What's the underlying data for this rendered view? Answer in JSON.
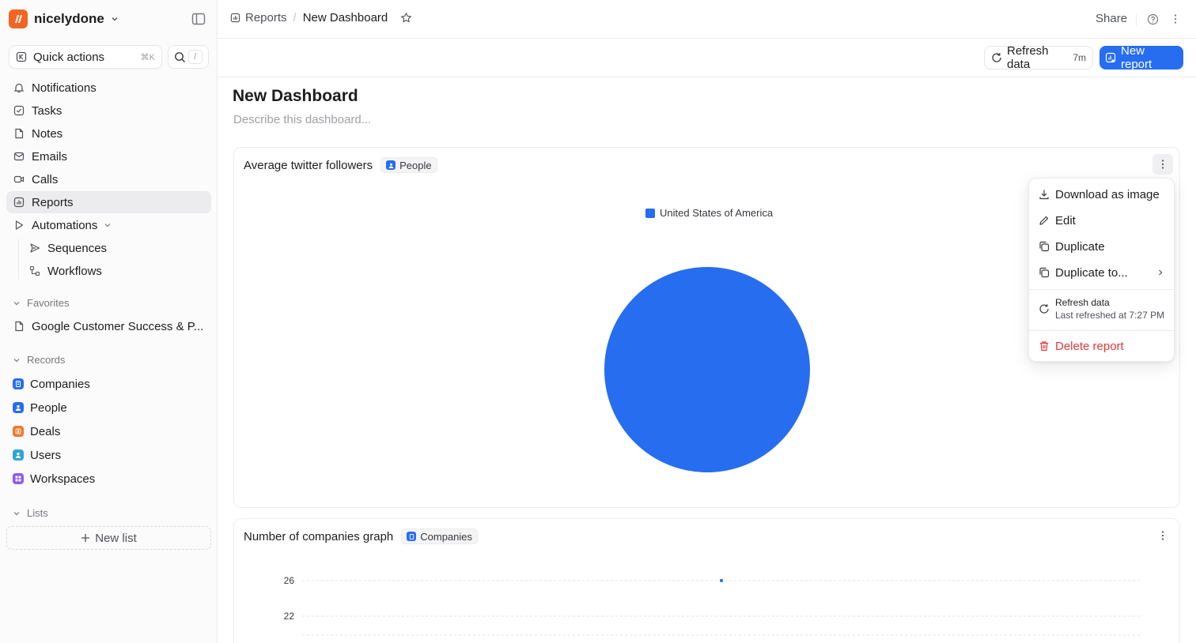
{
  "workspace": {
    "name": "nicelydone"
  },
  "quick_actions": {
    "label": "Quick actions",
    "shortcut": "⌘K",
    "search_shortcut": "/"
  },
  "nav": [
    {
      "label": "Notifications",
      "icon": "bell-icon"
    },
    {
      "label": "Tasks",
      "icon": "check-square-icon"
    },
    {
      "label": "Notes",
      "icon": "note-icon"
    },
    {
      "label": "Emails",
      "icon": "mail-icon"
    },
    {
      "label": "Calls",
      "icon": "video-icon"
    },
    {
      "label": "Reports",
      "icon": "reports-icon",
      "active": true
    },
    {
      "label": "Automations",
      "icon": "play-icon"
    }
  ],
  "automations_sub": [
    {
      "label": "Sequences",
      "icon": "send-icon"
    },
    {
      "label": "Workflows",
      "icon": "workflow-icon"
    }
  ],
  "favorites": {
    "heading": "Favorites",
    "items": [
      {
        "label": "Google Customer Success & P..."
      }
    ]
  },
  "records": {
    "heading": "Records",
    "items": [
      {
        "label": "Companies",
        "color": "#266df0"
      },
      {
        "label": "People",
        "color": "#266df0"
      },
      {
        "label": "Deals",
        "color": "#f2762e"
      },
      {
        "label": "Users",
        "color": "#2aa7d8"
      },
      {
        "label": "Workspaces",
        "color": "#8a5cf0"
      }
    ]
  },
  "lists": {
    "heading": "Lists",
    "new_list": "New list"
  },
  "breadcrumb": {
    "parent": "Reports",
    "current": "New Dashboard"
  },
  "topbar": {
    "share": "Share"
  },
  "toolbar": {
    "refresh_label": "Refresh data",
    "refresh_age": "7m",
    "new_report": "New report"
  },
  "dashboard": {
    "title": "New Dashboard",
    "description_placeholder": "Describe this dashboard..."
  },
  "card1": {
    "title": "Average twitter followers",
    "chip": "People",
    "chart_data": {
      "type": "pie",
      "labels": [
        "United States of America"
      ],
      "values": [
        100
      ],
      "colors": [
        "#266df0"
      ]
    }
  },
  "card2": {
    "title": "Number of companies graph",
    "chip": "Companies",
    "chart_data": {
      "type": "line",
      "y_ticks": [
        26,
        22
      ],
      "points_visible": [
        {
          "y": 26
        }
      ],
      "grid": true
    }
  },
  "menu": {
    "download": "Download as image",
    "edit": "Edit",
    "duplicate": "Duplicate",
    "duplicate_to": "Duplicate to...",
    "refresh": "Refresh data",
    "refresh_sub": "Last refreshed at 7:27 PM",
    "delete": "Delete report"
  },
  "colors": {
    "accent": "#266df0",
    "danger": "#e5383b",
    "brand": "#f26522"
  }
}
